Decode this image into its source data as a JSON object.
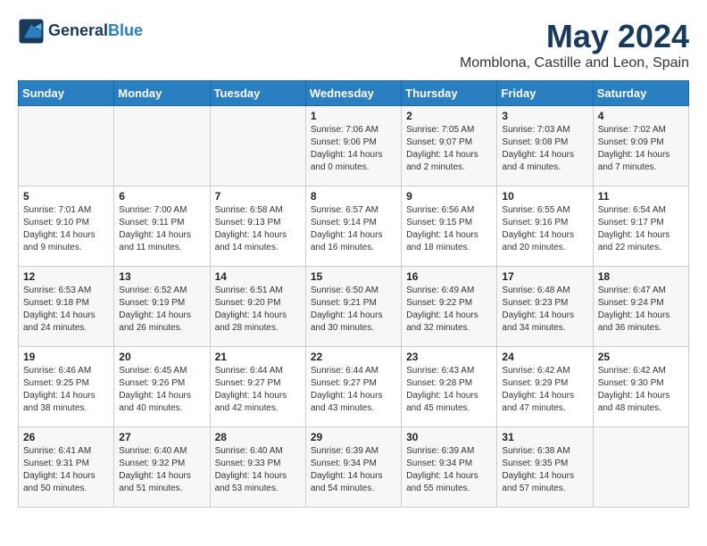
{
  "header": {
    "logo_line1": "General",
    "logo_line2": "Blue",
    "month": "May 2024",
    "location": "Momblona, Castille and Leon, Spain"
  },
  "weekdays": [
    "Sunday",
    "Monday",
    "Tuesday",
    "Wednesday",
    "Thursday",
    "Friday",
    "Saturday"
  ],
  "weeks": [
    [
      {
        "day": "",
        "sunrise": "",
        "sunset": "",
        "daylight": ""
      },
      {
        "day": "",
        "sunrise": "",
        "sunset": "",
        "daylight": ""
      },
      {
        "day": "",
        "sunrise": "",
        "sunset": "",
        "daylight": ""
      },
      {
        "day": "1",
        "sunrise": "Sunrise: 7:06 AM",
        "sunset": "Sunset: 9:06 PM",
        "daylight": "Daylight: 14 hours and 0 minutes."
      },
      {
        "day": "2",
        "sunrise": "Sunrise: 7:05 AM",
        "sunset": "Sunset: 9:07 PM",
        "daylight": "Daylight: 14 hours and 2 minutes."
      },
      {
        "day": "3",
        "sunrise": "Sunrise: 7:03 AM",
        "sunset": "Sunset: 9:08 PM",
        "daylight": "Daylight: 14 hours and 4 minutes."
      },
      {
        "day": "4",
        "sunrise": "Sunrise: 7:02 AM",
        "sunset": "Sunset: 9:09 PM",
        "daylight": "Daylight: 14 hours and 7 minutes."
      }
    ],
    [
      {
        "day": "5",
        "sunrise": "Sunrise: 7:01 AM",
        "sunset": "Sunset: 9:10 PM",
        "daylight": "Daylight: 14 hours and 9 minutes."
      },
      {
        "day": "6",
        "sunrise": "Sunrise: 7:00 AM",
        "sunset": "Sunset: 9:11 PM",
        "daylight": "Daylight: 14 hours and 11 minutes."
      },
      {
        "day": "7",
        "sunrise": "Sunrise: 6:58 AM",
        "sunset": "Sunset: 9:13 PM",
        "daylight": "Daylight: 14 hours and 14 minutes."
      },
      {
        "day": "8",
        "sunrise": "Sunrise: 6:57 AM",
        "sunset": "Sunset: 9:14 PM",
        "daylight": "Daylight: 14 hours and 16 minutes."
      },
      {
        "day": "9",
        "sunrise": "Sunrise: 6:56 AM",
        "sunset": "Sunset: 9:15 PM",
        "daylight": "Daylight: 14 hours and 18 minutes."
      },
      {
        "day": "10",
        "sunrise": "Sunrise: 6:55 AM",
        "sunset": "Sunset: 9:16 PM",
        "daylight": "Daylight: 14 hours and 20 minutes."
      },
      {
        "day": "11",
        "sunrise": "Sunrise: 6:54 AM",
        "sunset": "Sunset: 9:17 PM",
        "daylight": "Daylight: 14 hours and 22 minutes."
      }
    ],
    [
      {
        "day": "12",
        "sunrise": "Sunrise: 6:53 AM",
        "sunset": "Sunset: 9:18 PM",
        "daylight": "Daylight: 14 hours and 24 minutes."
      },
      {
        "day": "13",
        "sunrise": "Sunrise: 6:52 AM",
        "sunset": "Sunset: 9:19 PM",
        "daylight": "Daylight: 14 hours and 26 minutes."
      },
      {
        "day": "14",
        "sunrise": "Sunrise: 6:51 AM",
        "sunset": "Sunset: 9:20 PM",
        "daylight": "Daylight: 14 hours and 28 minutes."
      },
      {
        "day": "15",
        "sunrise": "Sunrise: 6:50 AM",
        "sunset": "Sunset: 9:21 PM",
        "daylight": "Daylight: 14 hours and 30 minutes."
      },
      {
        "day": "16",
        "sunrise": "Sunrise: 6:49 AM",
        "sunset": "Sunset: 9:22 PM",
        "daylight": "Daylight: 14 hours and 32 minutes."
      },
      {
        "day": "17",
        "sunrise": "Sunrise: 6:48 AM",
        "sunset": "Sunset: 9:23 PM",
        "daylight": "Daylight: 14 hours and 34 minutes."
      },
      {
        "day": "18",
        "sunrise": "Sunrise: 6:47 AM",
        "sunset": "Sunset: 9:24 PM",
        "daylight": "Daylight: 14 hours and 36 minutes."
      }
    ],
    [
      {
        "day": "19",
        "sunrise": "Sunrise: 6:46 AM",
        "sunset": "Sunset: 9:25 PM",
        "daylight": "Daylight: 14 hours and 38 minutes."
      },
      {
        "day": "20",
        "sunrise": "Sunrise: 6:45 AM",
        "sunset": "Sunset: 9:26 PM",
        "daylight": "Daylight: 14 hours and 40 minutes."
      },
      {
        "day": "21",
        "sunrise": "Sunrise: 6:44 AM",
        "sunset": "Sunset: 9:27 PM",
        "daylight": "Daylight: 14 hours and 42 minutes."
      },
      {
        "day": "22",
        "sunrise": "Sunrise: 6:44 AM",
        "sunset": "Sunset: 9:27 PM",
        "daylight": "Daylight: 14 hours and 43 minutes."
      },
      {
        "day": "23",
        "sunrise": "Sunrise: 6:43 AM",
        "sunset": "Sunset: 9:28 PM",
        "daylight": "Daylight: 14 hours and 45 minutes."
      },
      {
        "day": "24",
        "sunrise": "Sunrise: 6:42 AM",
        "sunset": "Sunset: 9:29 PM",
        "daylight": "Daylight: 14 hours and 47 minutes."
      },
      {
        "day": "25",
        "sunrise": "Sunrise: 6:42 AM",
        "sunset": "Sunset: 9:30 PM",
        "daylight": "Daylight: 14 hours and 48 minutes."
      }
    ],
    [
      {
        "day": "26",
        "sunrise": "Sunrise: 6:41 AM",
        "sunset": "Sunset: 9:31 PM",
        "daylight": "Daylight: 14 hours and 50 minutes."
      },
      {
        "day": "27",
        "sunrise": "Sunrise: 6:40 AM",
        "sunset": "Sunset: 9:32 PM",
        "daylight": "Daylight: 14 hours and 51 minutes."
      },
      {
        "day": "28",
        "sunrise": "Sunrise: 6:40 AM",
        "sunset": "Sunset: 9:33 PM",
        "daylight": "Daylight: 14 hours and 53 minutes."
      },
      {
        "day": "29",
        "sunrise": "Sunrise: 6:39 AM",
        "sunset": "Sunset: 9:34 PM",
        "daylight": "Daylight: 14 hours and 54 minutes."
      },
      {
        "day": "30",
        "sunrise": "Sunrise: 6:39 AM",
        "sunset": "Sunset: 9:34 PM",
        "daylight": "Daylight: 14 hours and 55 minutes."
      },
      {
        "day": "31",
        "sunrise": "Sunrise: 6:38 AM",
        "sunset": "Sunset: 9:35 PM",
        "daylight": "Daylight: 14 hours and 57 minutes."
      },
      {
        "day": "",
        "sunrise": "",
        "sunset": "",
        "daylight": ""
      }
    ]
  ]
}
